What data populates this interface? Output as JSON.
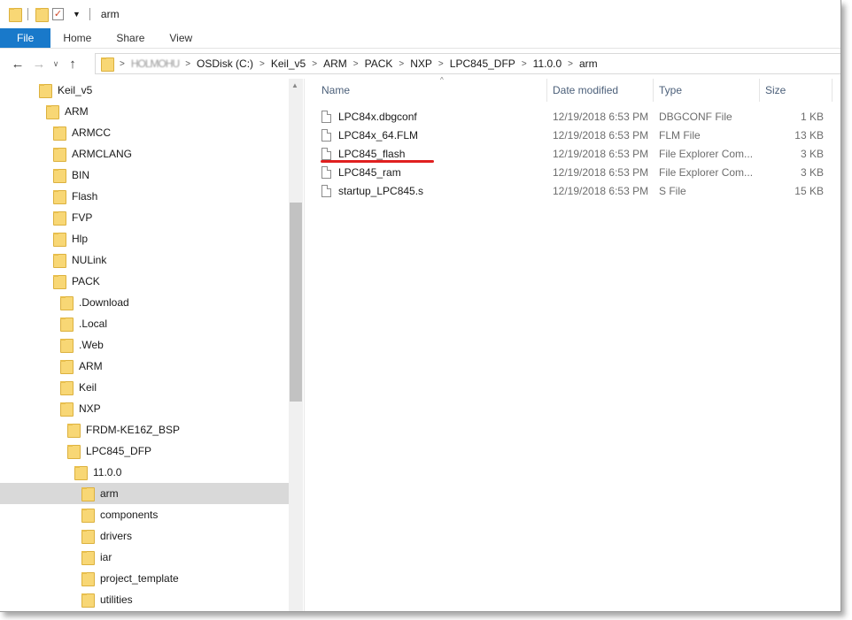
{
  "window": {
    "title": "arm"
  },
  "ribbon": {
    "tabs": [
      "File",
      "Home",
      "Share",
      "View"
    ]
  },
  "addressbar": {
    "crumbs": [
      "HOLMOHU",
      "OSDisk (C:)",
      "Keil_v5",
      "ARM",
      "PACK",
      "NXP",
      "LPC845_DFP",
      "11.0.0",
      "arm"
    ]
  },
  "tree": {
    "items": [
      {
        "label": "Keil_v5"
      },
      {
        "label": "ARM"
      },
      {
        "label": "ARMCC"
      },
      {
        "label": "ARMCLANG"
      },
      {
        "label": "BIN"
      },
      {
        "label": "Flash"
      },
      {
        "label": "FVP"
      },
      {
        "label": "Hlp"
      },
      {
        "label": "NULink"
      },
      {
        "label": "PACK"
      },
      {
        "label": ".Download"
      },
      {
        "label": ".Local"
      },
      {
        "label": ".Web"
      },
      {
        "label": "ARM"
      },
      {
        "label": "Keil"
      },
      {
        "label": "NXP"
      },
      {
        "label": "FRDM-KE16Z_BSP"
      },
      {
        "label": "LPC845_DFP"
      },
      {
        "label": "11.0.0"
      },
      {
        "label": "arm",
        "selected": true
      },
      {
        "label": "components"
      },
      {
        "label": "drivers"
      },
      {
        "label": "iar"
      },
      {
        "label": "project_template"
      },
      {
        "label": "utilities"
      }
    ]
  },
  "filelist": {
    "columns": {
      "name": "Name",
      "date": "Date modified",
      "type": "Type",
      "size": "Size"
    },
    "files": [
      {
        "name": "LPC84x.dbgconf",
        "date": "12/19/2018 6:53 PM",
        "type": "DBGCONF File",
        "size": "1 KB"
      },
      {
        "name": "LPC84x_64.FLM",
        "date": "12/19/2018 6:53 PM",
        "type": "FLM File",
        "size": "13 KB"
      },
      {
        "name": "LPC845_flash",
        "date": "12/19/2018 6:53 PM",
        "type": "File Explorer Com...",
        "size": "3 KB"
      },
      {
        "name": "LPC845_ram",
        "date": "12/19/2018 6:53 PM",
        "type": "File Explorer Com...",
        "size": "3 KB"
      },
      {
        "name": "startup_LPC845.s",
        "date": "12/19/2018 6:53 PM",
        "type": "S File",
        "size": "15 KB"
      }
    ]
  },
  "colors": {
    "file_tab": "#1979ca",
    "folder": "#f8d775",
    "annotation": "#e02020",
    "selected": "#d9d9d9"
  },
  "icons": {
    "back": "arrow-left-icon",
    "forward": "arrow-right-icon",
    "up": "arrow-up-icon",
    "recent": "chevron-down-icon",
    "folder": "folder-icon",
    "file": "file-icon"
  }
}
